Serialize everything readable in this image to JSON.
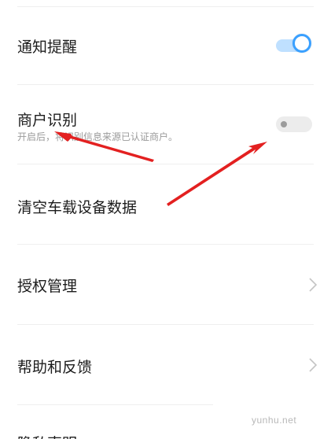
{
  "settings": {
    "notification": {
      "title": "通知提醒",
      "enabled": true
    },
    "merchant": {
      "title": "商户识别",
      "subtitle": "开启后，将识别信息来源已认证商户。",
      "enabled": false
    },
    "clear_data": {
      "title": "清空车载设备数据"
    },
    "authorization": {
      "title": "授权管理"
    },
    "help": {
      "title": "帮助和反馈"
    },
    "privacy": {
      "title": "隐私声明"
    }
  },
  "watermark": "yunhu.net",
  "colors": {
    "toggle_on_track": "#bfe0ff",
    "toggle_on_ring": "#3aa0ff",
    "toggle_off_track": "#ececec",
    "annotation_arrow": "#e32020"
  },
  "icons": {
    "chevron": "chevron-right-icon"
  }
}
